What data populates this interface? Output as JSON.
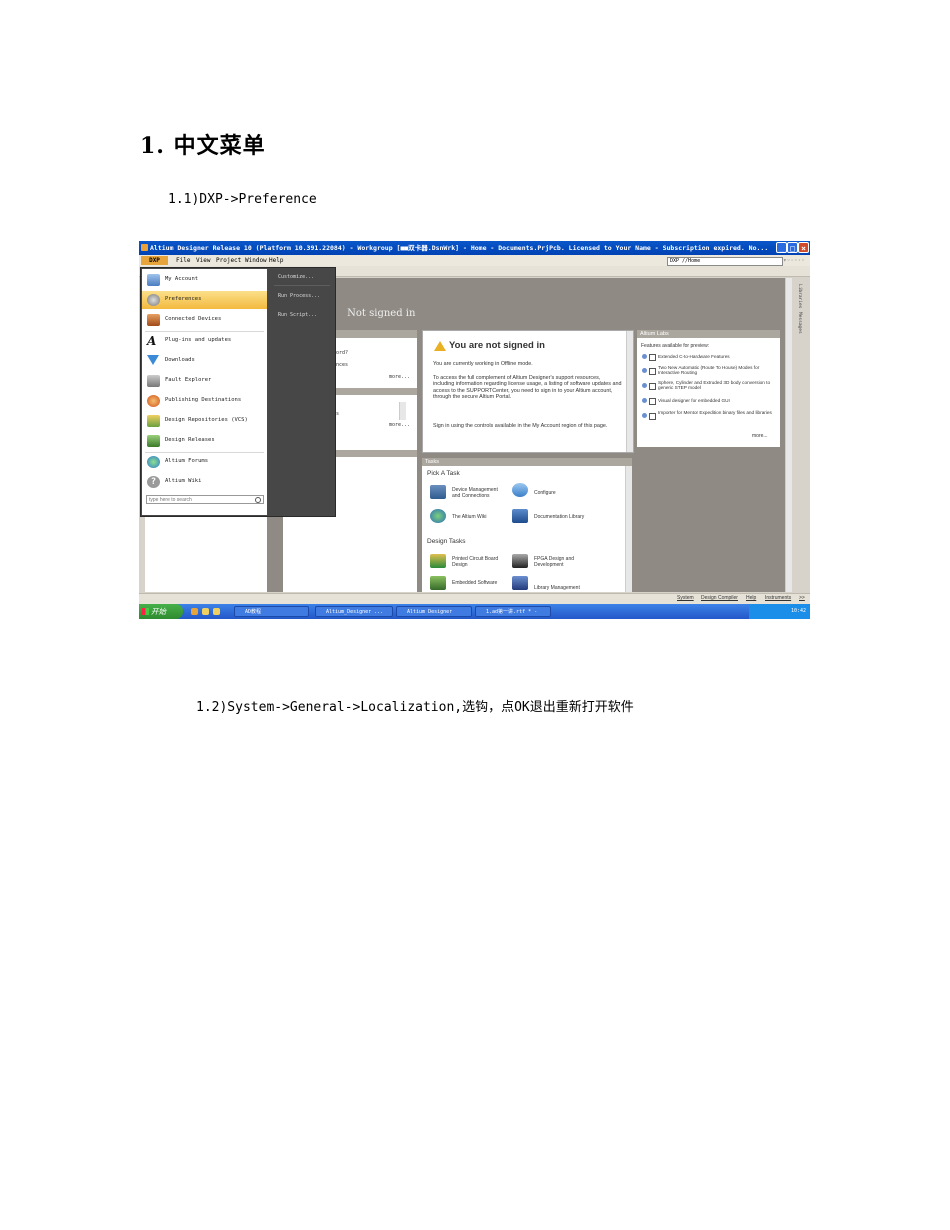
{
  "document": {
    "heading": "1. 中文菜单",
    "step1": "1.1)DXP->Preference",
    "step2": "1.2)System->General->Localization,选钩，点OK退出重新打开软件"
  },
  "screenshot": {
    "window_title": "Altium Designer Release 10 (Platform 10.391.22084) - Workgroup [■■双卡器.DsnWrk] - Home - Documents.PrjPcb. Licensed to Your Name - Subscription expired. No...",
    "menubar": {
      "dxp": "DXP",
      "items": [
        "File",
        "View",
        "Project",
        "Window",
        "Help"
      ],
      "path": "DXP //Home"
    },
    "dxp_menu": {
      "items": [
        "My Account",
        "Preferences",
        "Connected Devices",
        "Plug-ins and updates",
        "Downloads",
        "Fault Explorer",
        "Publishing Destinations",
        "Design Repositories (VCS)",
        "Design Releases",
        "Altium Forums",
        "Altium Wiki"
      ],
      "search_placeholder": "type here to search",
      "right_items": [
        "Customize...",
        "Run Process...",
        "Run Script..."
      ]
    },
    "banner": {
      "char": "Z",
      "text": "Not signed in"
    },
    "left_panel": {
      "line1": "word?",
      "line2": "ences",
      "more1": "more...",
      "line3": "ss",
      "more2": "more..."
    },
    "signin": {
      "title": "You are not signed in",
      "p1": "You are currently working in Offline mode.",
      "p2": "To access the full complement of Altium Designer's support resources, including information regarding license usage, a listing of software updates and access to the SUPPORTCenter, you need to sign in to your Altium account, through the secure Altium Portal.",
      "p3": "Sign in using the controls available in the My Account region of this page."
    },
    "tasks": {
      "header": "Tasks",
      "pick": "Pick A Task",
      "items": [
        "Device Management and Connections",
        "Configure",
        "The Altium Wiki",
        "Documentation Library"
      ],
      "design": "Design Tasks",
      "design_items": [
        "Printed Circuit Board Design",
        "FPGA Design and Development",
        "Embedded Software",
        "Library Management"
      ]
    },
    "labs": {
      "header": "Altium Labs",
      "intro": "Features available for preview:",
      "items": [
        "Extended C-to-Hardware Features",
        "Two New Automatic (Route To House) Modes for Interactive Routing",
        "Sphere, Cylinder and Extruded 3D body conversion to generic STEP model",
        "Visual designer for embedded GUI",
        "Importer for Mentor Expedition binary files and libraries"
      ],
      "more": "more..."
    },
    "side_tabs": [
      "Libraries",
      "Messages"
    ],
    "status_links": [
      "System",
      "Design Compiler",
      "Help",
      "Instruments",
      ">>"
    ],
    "taskbar": {
      "start": "开始",
      "buttons": [
        "AD教程",
        "Altium_Designer ...",
        "Altium Designer",
        "1.ad第一讲.rtf * -"
      ],
      "clock": "10:42"
    },
    "colors": {
      "titlebar": "#0a57c9",
      "highlight": "#f3b93e",
      "dark_menu": "#474747",
      "taskbar": "#2457c8"
    }
  }
}
